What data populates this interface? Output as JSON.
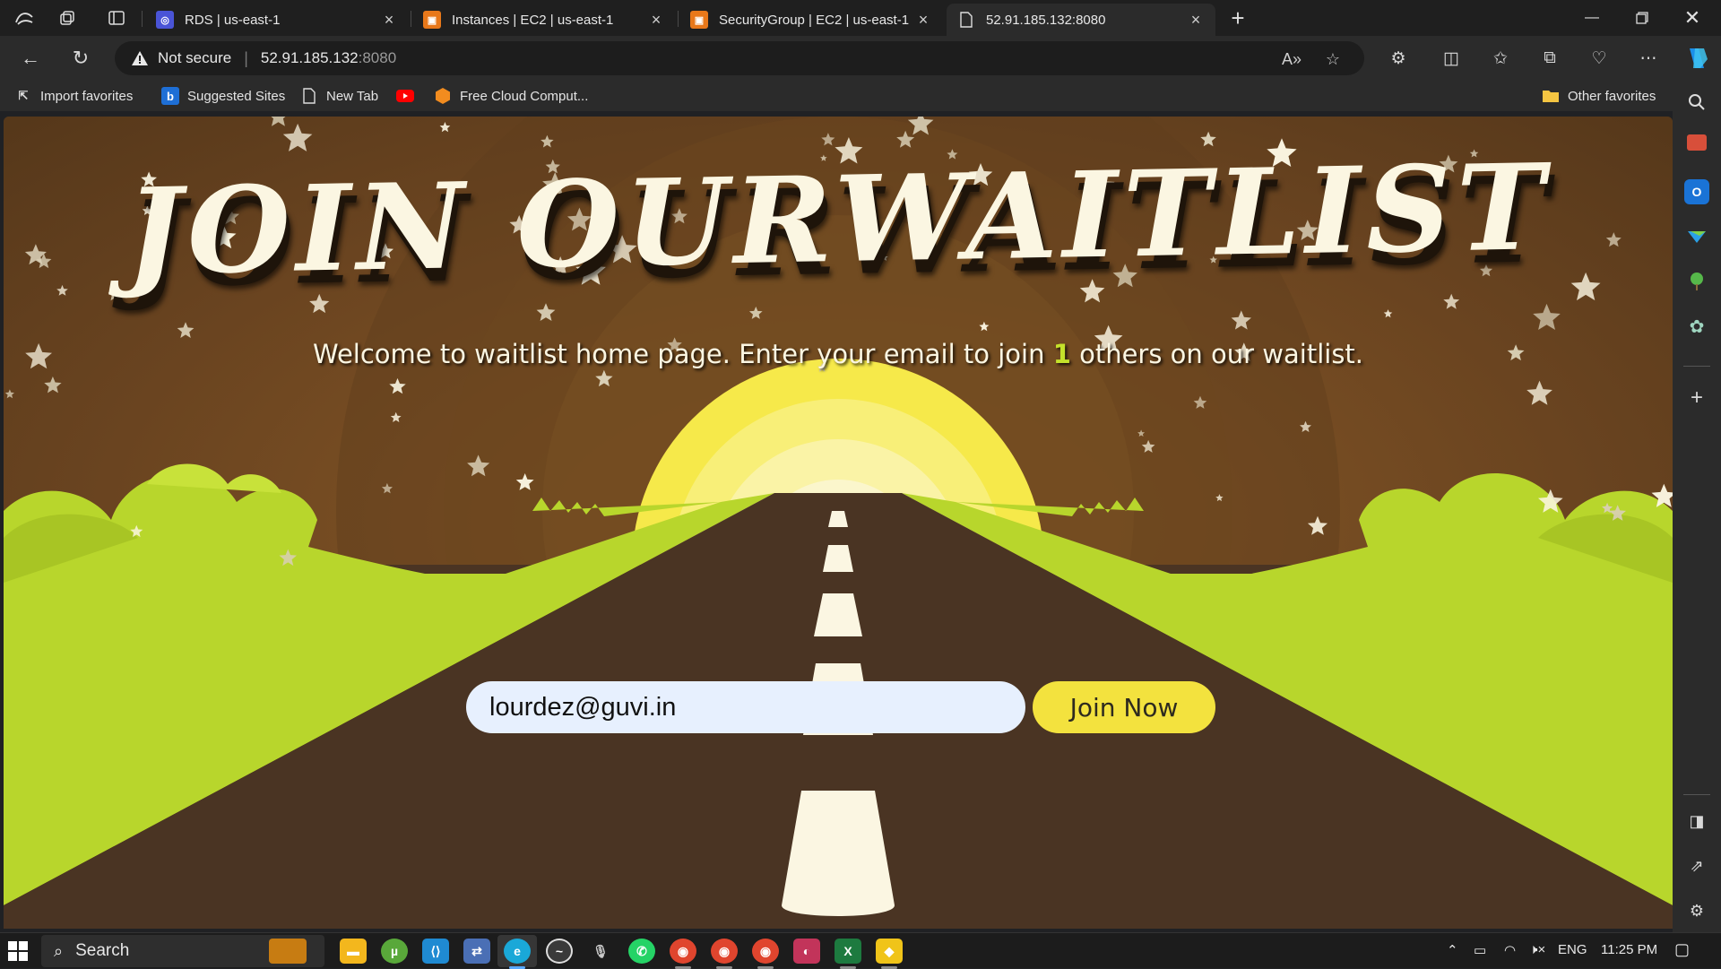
{
  "browser": {
    "tabs": [
      {
        "title": "RDS | us-east-1",
        "icon": "rds-icon",
        "color": "#4a54d6"
      },
      {
        "title": "Instances | EC2 | us-east-1",
        "icon": "aws-ec2-icon",
        "color": "#e8781a"
      },
      {
        "title": "SecurityGroup | EC2 | us-east-1",
        "icon": "aws-ec2-icon",
        "color": "#e8781a"
      },
      {
        "title": "52.91.185.132:8080",
        "icon": "page-icon",
        "color": "#cfcfcf",
        "active": true
      }
    ],
    "address": {
      "security_label": "Not secure",
      "host": "52.91.185.132",
      "port": ":8080"
    },
    "favorites": [
      {
        "label": "Import favorites",
        "icon": "import-icon"
      },
      {
        "label": "Suggested Sites",
        "icon": "bing-icon"
      },
      {
        "label": "New Tab",
        "icon": "page-icon"
      },
      {
        "label": "",
        "icon": "youtube-icon"
      },
      {
        "label": "Free Cloud Comput...",
        "icon": "cloud-icon"
      },
      {
        "label": "Other favorites",
        "icon": "folder-icon"
      }
    ]
  },
  "page": {
    "title": "JOIN OURWAITLIST",
    "subtitle_before": "Welcome to waitlist home page. Enter your email to join ",
    "waitlist_count": "1",
    "subtitle_after": " others on our waitlist.",
    "email_value": "lourdez@guvi.in",
    "join_button": "Join Now",
    "colors": {
      "sky": "#5a3b1c",
      "sun": "#f7ec4a",
      "grass": "#b8d62c",
      "road": "#4a3423",
      "road_marking": "#fbf6e2",
      "button": "#f3e23e",
      "count_highlight": "#c4e12b"
    }
  },
  "taskbar": {
    "search_placeholder": "Search",
    "language": "ENG",
    "time": "11:25 PM"
  }
}
